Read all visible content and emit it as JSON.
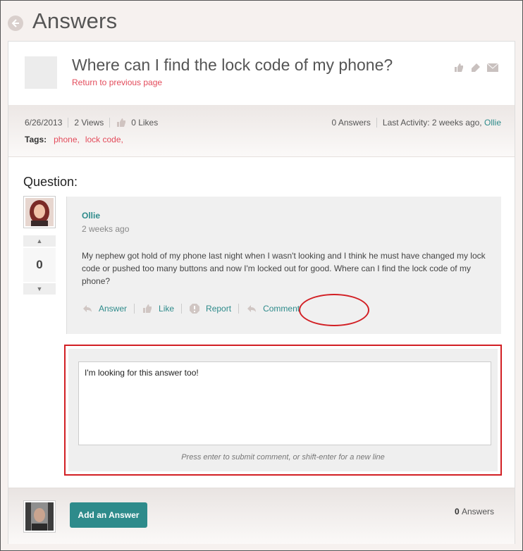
{
  "header": {
    "title": "Answers",
    "back_icon": "back-arrow-circle-icon"
  },
  "question": {
    "title": "Where can I find the lock code of my phone?",
    "return_link": "Return to previous page",
    "date": "6/26/2013",
    "views": "2 Views",
    "likes": "0 Likes",
    "answers_count": "0 Answers",
    "last_activity_label": "Last Activity: 2 weeks ago,",
    "last_activity_user": "Ollie",
    "tags_label": "Tags:",
    "tags": [
      "phone,",
      "lock code,"
    ]
  },
  "section": {
    "heading": "Question:"
  },
  "vote": {
    "up": "▲",
    "count": "0",
    "down": "▼"
  },
  "post": {
    "author": "Ollie",
    "time": "2 weeks ago",
    "body": "My nephew got hold of my phone last night when I wasn't looking and I think he must have changed my lock code or pushed too many buttons and now I'm locked out for good. Where can I find the lock code of my phone?",
    "actions": {
      "answer": "Answer",
      "like": "Like",
      "report": "Report",
      "comment": "Comment"
    }
  },
  "comment": {
    "value": "I'm looking for this answer too!",
    "hint": "Press enter to submit comment, or shift-enter for a new line"
  },
  "footer": {
    "add_button": "Add an Answer",
    "count": "0",
    "count_label": "Answers"
  },
  "colors": {
    "accent": "#2e8b8b",
    "link_red": "#e34b5b",
    "highlight_red": "#d21f24"
  }
}
